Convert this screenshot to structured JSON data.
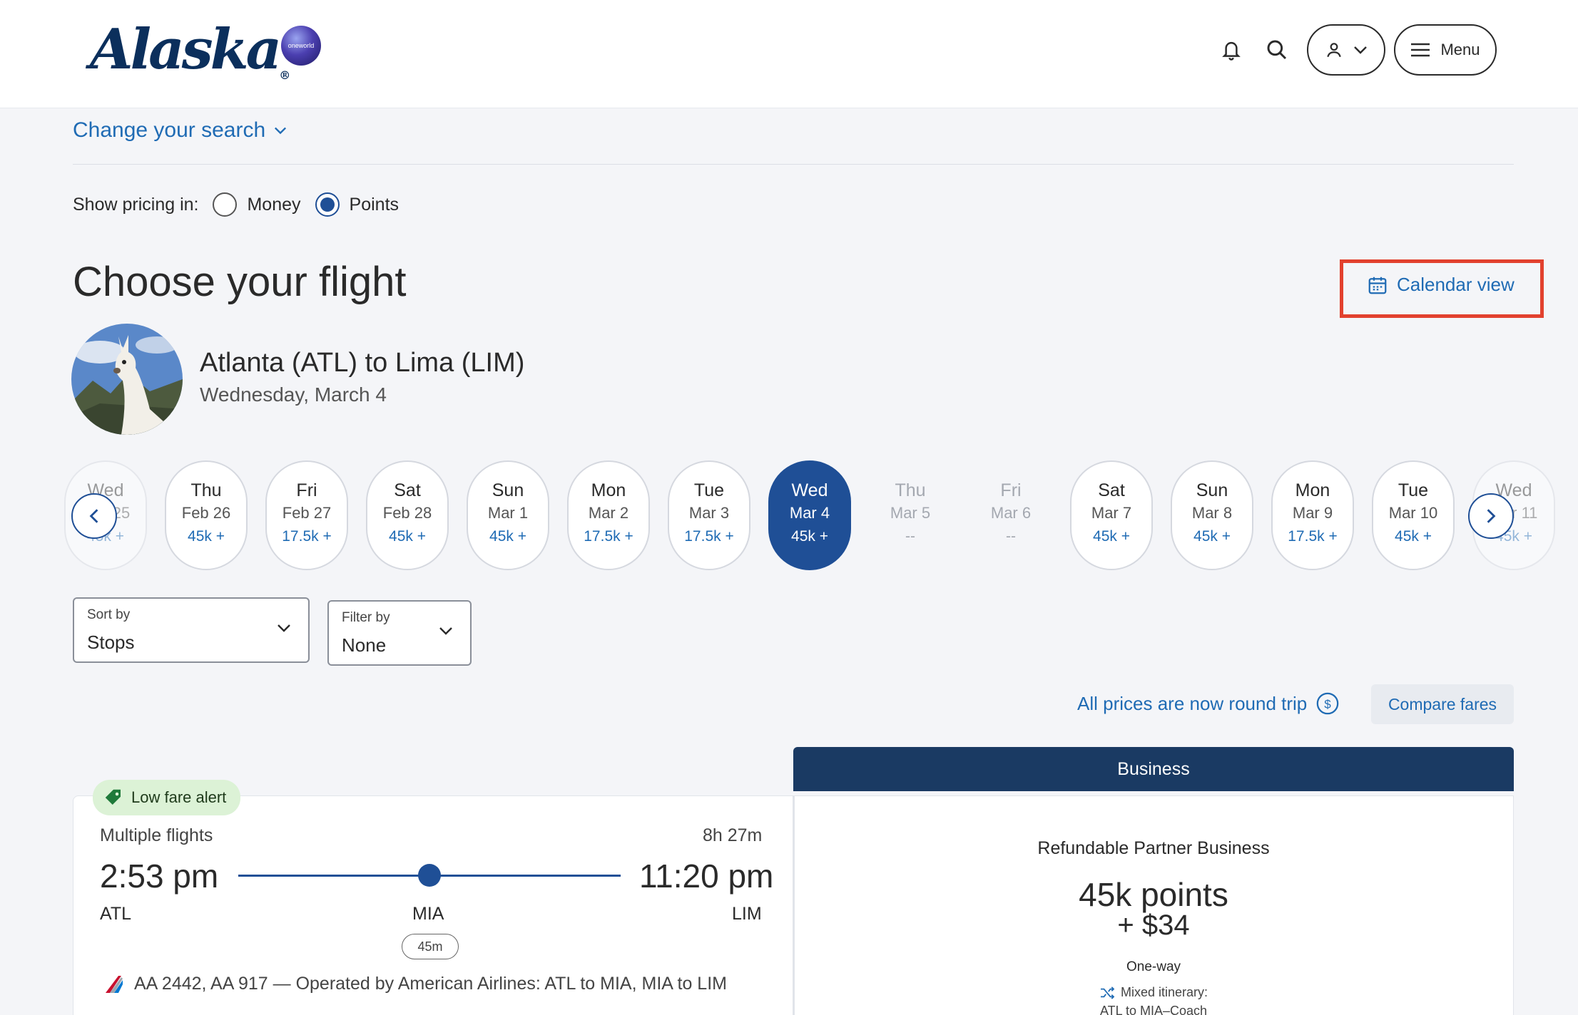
{
  "header": {
    "logo": "Alaska",
    "logo_mark": "®",
    "alliance": "oneworld",
    "menu_label": "Menu"
  },
  "search": {
    "change_label": "Change your search"
  },
  "pricing": {
    "label": "Show pricing in:",
    "money": "Money",
    "points": "Points",
    "selected": "points"
  },
  "page_title": "Choose your flight",
  "calendar_view": "Calendar view",
  "route": {
    "title": "Atlanta (ATL) to Lima (LIM)",
    "date": "Wednesday, March 4"
  },
  "dates": [
    {
      "day": "Wed",
      "date": "Feb 25",
      "price": "45k +",
      "state": "partial"
    },
    {
      "day": "Thu",
      "date": "Feb 26",
      "price": "45k +",
      "state": "normal"
    },
    {
      "day": "Fri",
      "date": "Feb 27",
      "price": "17.5k +",
      "state": "normal"
    },
    {
      "day": "Sat",
      "date": "Feb 28",
      "price": "45k +",
      "state": "normal"
    },
    {
      "day": "Sun",
      "date": "Mar 1",
      "price": "45k +",
      "state": "normal"
    },
    {
      "day": "Mon",
      "date": "Mar 2",
      "price": "17.5k +",
      "state": "normal"
    },
    {
      "day": "Tue",
      "date": "Mar 3",
      "price": "17.5k +",
      "state": "normal"
    },
    {
      "day": "Wed",
      "date": "Mar 4",
      "price": "45k +",
      "state": "selected"
    },
    {
      "day": "Thu",
      "date": "Mar 5",
      "price": "--",
      "state": "unavailable"
    },
    {
      "day": "Fri",
      "date": "Mar 6",
      "price": "--",
      "state": "unavailable"
    },
    {
      "day": "Sat",
      "date": "Mar 7",
      "price": "45k +",
      "state": "normal"
    },
    {
      "day": "Sun",
      "date": "Mar 8",
      "price": "45k +",
      "state": "normal"
    },
    {
      "day": "Mon",
      "date": "Mar 9",
      "price": "17.5k +",
      "state": "normal"
    },
    {
      "day": "Tue",
      "date": "Mar 10",
      "price": "45k +",
      "state": "normal"
    },
    {
      "day": "Wed",
      "date": "Mar 11",
      "price": "45k +",
      "state": "partial"
    }
  ],
  "sort": {
    "label": "Sort by",
    "value": "Stops"
  },
  "filter": {
    "label": "Filter by",
    "value": "None"
  },
  "roundtrip_note": "All prices are now round trip",
  "compare_fares": "Compare fares",
  "flight": {
    "badge": "Low fare alert",
    "type": "Multiple flights",
    "duration": "8h 27m",
    "depart_time": "2:53 pm",
    "arrive_time": "11:20 pm",
    "origin": "ATL",
    "connection": "MIA",
    "destination": "LIM",
    "layover": "45m",
    "operated_by": "AA 2442, AA 917 — Operated by American Airlines: ATL to MIA, MIA to LIM"
  },
  "fare": {
    "cabin": "Business",
    "name": "Refundable Partner Business",
    "points": "45k points",
    "cash": "+ $34",
    "trip": "One-way",
    "mixed": "Mixed itinerary:",
    "mixed_detail": "ATL to MIA–Coach"
  },
  "colors": {
    "brand_navy": "#1a3a63",
    "link_blue": "#1f6bb4",
    "selected_blue": "#1f4f96",
    "highlight_red": "#e2412e",
    "badge_green": "#dcf2d6"
  }
}
